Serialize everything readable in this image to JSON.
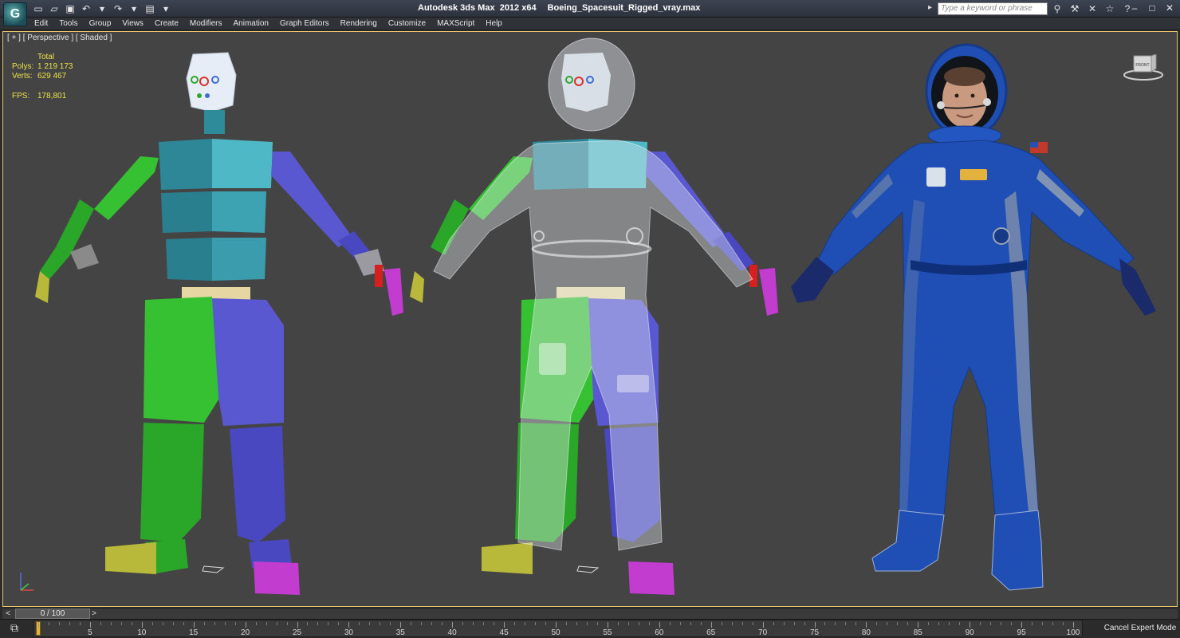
{
  "titlebar": {
    "app_name": "Autodesk 3ds Max  2012 x64",
    "file_name": "Boeing_Spacesuit_Rigged_vray.max",
    "search_placeholder": "Type a keyword or phrase",
    "logo_glyph": "G"
  },
  "menu": {
    "items": [
      "Edit",
      "Tools",
      "Group",
      "Views",
      "Create",
      "Modifiers",
      "Animation",
      "Graph Editors",
      "Rendering",
      "Customize",
      "MAXScript",
      "Help"
    ]
  },
  "viewport": {
    "label": "[ + ] [ Perspective ] [ Shaded ]",
    "stats": {
      "total_label": "Total",
      "polys_label": "Polys:",
      "polys_value": "1 219 173",
      "verts_label": "Verts:",
      "verts_value": "629 467",
      "fps_label": "FPS:",
      "fps_value": "178,801"
    },
    "viewcube_label": "FRONT"
  },
  "timeline": {
    "frame_display": "0 / 100",
    "tick_labels": [
      "0",
      "5",
      "10",
      "15",
      "20",
      "25",
      "30",
      "35",
      "40",
      "45",
      "50",
      "55",
      "60",
      "65",
      "70",
      "75",
      "80",
      "85",
      "90",
      "95",
      "100"
    ]
  },
  "status": {
    "cancel_expert": "Cancel Expert Mode"
  },
  "colors": {
    "viewport_bg": "#444444",
    "active_border": "#e8c26a",
    "stats_text": "#ece24a",
    "suit_blue": "#1f4fb5",
    "rig_green": "#2fb52a",
    "rig_teal": "#2e8c9a",
    "rig_purple": "#5a58d0"
  }
}
